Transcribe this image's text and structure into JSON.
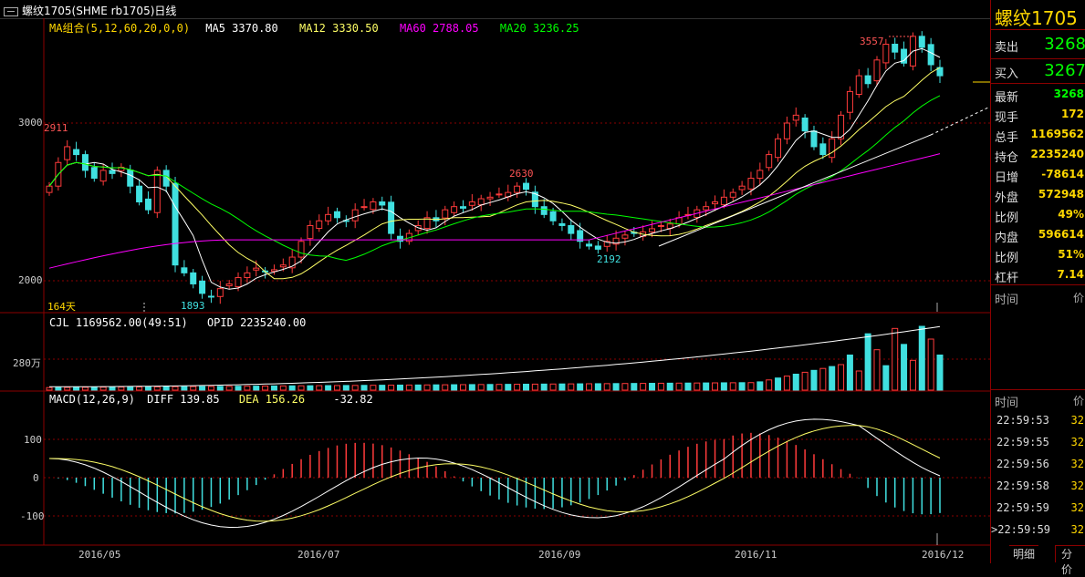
{
  "window": {
    "title": "螺纹1705(SHME rb1705)日线"
  },
  "ma_legend": {
    "group": "MA组合(5,12,60,20,0,0)",
    "ma5": "MA5 3370.80",
    "ma12": "MA12 3330.50",
    "ma60": "MA60 2788.05",
    "ma20": "MA20 3236.25"
  },
  "price_axis": {
    "p3000": "3000",
    "p2000": "2000"
  },
  "annotations": {
    "high_2911": "2911",
    "low_1893": "1893",
    "high_2630": "2630",
    "low_2192": "2192",
    "high_3557": "3557",
    "days": "164天"
  },
  "volume_legend": {
    "cjl": "CJL  1169562.00(49:51)",
    "opid": "OPID  2235240.00"
  },
  "volume_axis": {
    "v280": "280万"
  },
  "macd_legend": {
    "macd": "MACD(12,26,9)",
    "diff": "DIFF  139.85",
    "dea": "DEA  156.26",
    "macd_val": "-32.82"
  },
  "macd_axis": {
    "m100": "100",
    "m0": "0",
    "mneg100": "-100"
  },
  "date_axis": {
    "d1": "2016/05",
    "d2": "2016/07",
    "d3": "2016/09",
    "d4": "2016/11",
    "d5": "2016/12"
  },
  "quote_panel": {
    "name": "螺纹1705",
    "sell_label": "卖出",
    "sell_value": "3268",
    "buy_label": "买入",
    "buy_value": "3267",
    "rows": [
      {
        "label": "最新",
        "value": "3268",
        "color": "#00ff00"
      },
      {
        "label": "现手",
        "value": "172",
        "color": "#ffd700"
      },
      {
        "label": "总手",
        "value": "1169562",
        "color": "#ffd700"
      },
      {
        "label": "持仓",
        "value": "2235240",
        "color": "#ffd700"
      },
      {
        "label": "日增",
        "value": "-78614",
        "color": "#ffd700"
      },
      {
        "label": "外盘",
        "value": "572948",
        "color": "#ffd700"
      },
      {
        "label": "比例",
        "value": "49%",
        "color": "#ffd700"
      },
      {
        "label": "内盘",
        "value": "596614",
        "color": "#ffd700"
      },
      {
        "label": "比例",
        "value": "51%",
        "color": "#ffd700"
      },
      {
        "label": "杠杆",
        "value": "7.14",
        "color": "#ffd700"
      }
    ],
    "time_header": "时间",
    "price_header": "价",
    "time_header2": "时间",
    "price_header2": "价",
    "ticks": [
      {
        "time": "22:59:53",
        "price": "32"
      },
      {
        "time": "22:59:55",
        "price": "32"
      },
      {
        "time": "22:59:56",
        "price": "32"
      },
      {
        "time": "22:59:58",
        "price": "32"
      },
      {
        "time": "22:59:59",
        "price": "32"
      },
      {
        "time": ">22:59:59",
        "price": "32"
      }
    ],
    "tab_detail": "明细",
    "tab_split": "分价"
  },
  "chart_data": {
    "type": "candlestick",
    "instrument": "螺纹1705(SHME rb1705)",
    "period": "日线",
    "closes": [
      2600,
      2750,
      2850,
      2800,
      2700,
      2650,
      2700,
      2680,
      2720,
      2600,
      2500,
      2450,
      2700,
      2600,
      2100,
      2050,
      1980,
      1920,
      1900,
      1950,
      1980,
      2020,
      2050,
      2080,
      2060,
      2070,
      2100,
      2150,
      2250,
      2350,
      2380,
      2420,
      2400,
      2380,
      2450,
      2470,
      2500,
      2480,
      2300,
      2250,
      2300,
      2350,
      2400,
      2380,
      2450,
      2470,
      2460,
      2500,
      2520,
      2530,
      2550,
      2560,
      2600,
      2580,
      2470,
      2420,
      2380,
      2350,
      2300,
      2250,
      2220,
      2200,
      2250,
      2270,
      2290,
      2300,
      2310,
      2330,
      2350,
      2360,
      2400,
      2420,
      2450,
      2470,
      2500,
      2530,
      2560,
      2600,
      2650,
      2700,
      2800,
      2900,
      3000,
      3050,
      2950,
      2850,
      2800,
      2900,
      3050,
      3200,
      3300,
      3250,
      3400,
      3500,
      3450,
      3380,
      3550,
      3480,
      3370,
      3300
    ]
  },
  "colors": {
    "up": "#ff3b3b",
    "down": "#40e0e0",
    "ma5": "#ffffff",
    "ma12": "#ffff66",
    "ma60": "#ff00ff",
    "ma20": "#00ff00"
  }
}
